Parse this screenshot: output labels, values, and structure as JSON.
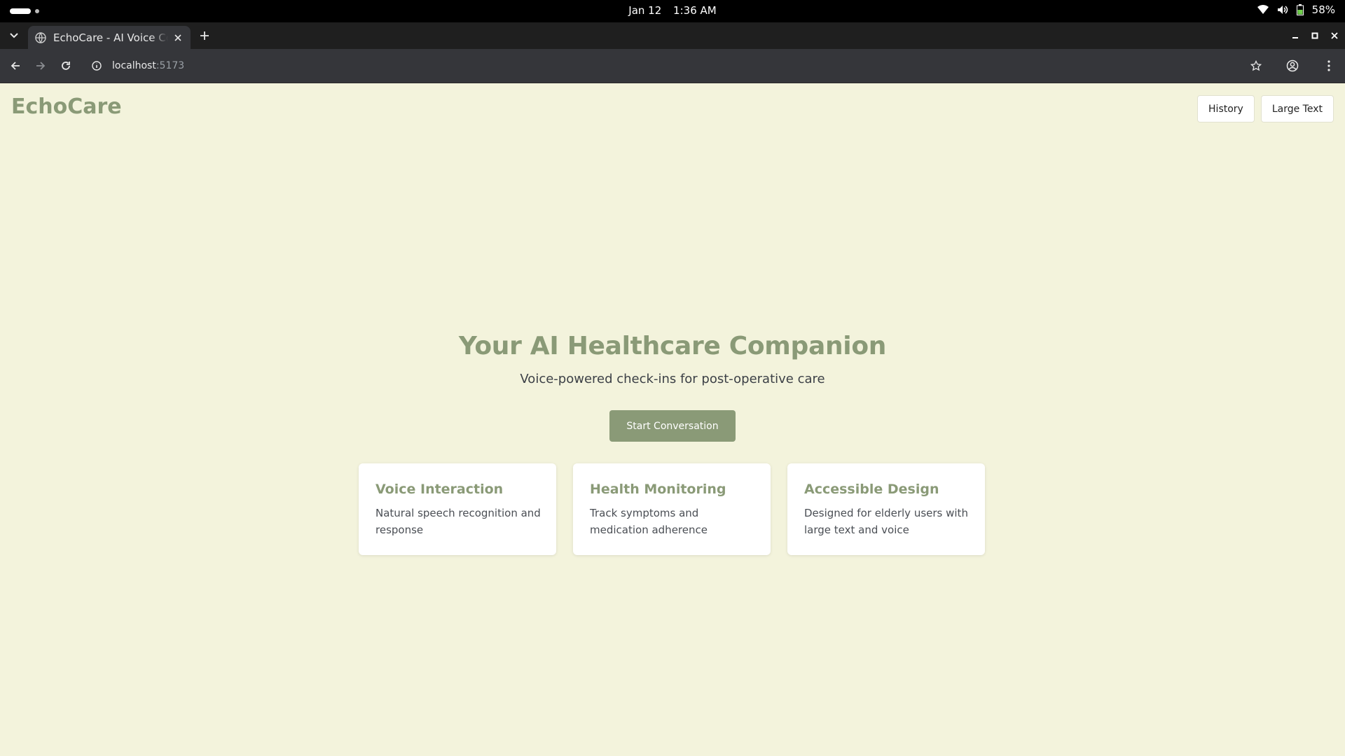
{
  "os": {
    "date": "Jan 12",
    "time": "1:36 AM",
    "battery": "58%",
    "icons": [
      "wifi-icon",
      "volume-icon",
      "battery-icon"
    ]
  },
  "browser": {
    "tab_title": "EchoCare - AI Voice Companion",
    "url_host": "localhost",
    "url_port": ":5173"
  },
  "app": {
    "logo": "EchoCare",
    "header_buttons": {
      "history": "History",
      "large_text": "Large Text"
    },
    "hero": {
      "title": "Your AI Healthcare Companion",
      "subtitle": "Voice-powered check-ins for post-operative care",
      "cta": "Start Conversation"
    },
    "features": [
      {
        "title": "Voice Interaction",
        "description": "Natural speech recognition and response"
      },
      {
        "title": "Health Monitoring",
        "description": "Track symptoms and medication adherence"
      },
      {
        "title": "Accessible Design",
        "description": "Designed for elderly users with large text and voice"
      }
    ]
  },
  "colors": {
    "brand": "#8a9a77",
    "page_background": "#f3f3dc",
    "card_background": "#ffffff"
  }
}
